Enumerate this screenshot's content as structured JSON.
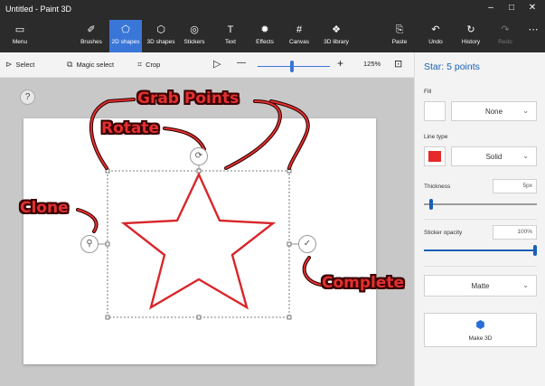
{
  "window": {
    "title": "Untitled - Paint 3D",
    "minimize": "–",
    "maximize": "□",
    "close": "✕"
  },
  "ribbon": {
    "items": [
      {
        "label": "Menu",
        "glyph": "▭"
      },
      {
        "label": "Brushes",
        "glyph": "✐"
      },
      {
        "label": "2D shapes",
        "glyph": "⬠"
      },
      {
        "label": "3D shapes",
        "glyph": "⬡"
      },
      {
        "label": "Stickers",
        "glyph": "◎"
      },
      {
        "label": "Text",
        "glyph": "T"
      },
      {
        "label": "Effects",
        "glyph": "✹"
      },
      {
        "label": "Canvas",
        "glyph": "#"
      },
      {
        "label": "3D library",
        "glyph": "❖"
      },
      {
        "label": "Paste",
        "glyph": "⎘"
      },
      {
        "label": "Undo",
        "glyph": "↶"
      },
      {
        "label": "History",
        "glyph": "↻"
      },
      {
        "label": "Redo",
        "glyph": "↷"
      },
      {
        "label": "",
        "glyph": "⋯"
      }
    ],
    "active_index": 2
  },
  "toolbar": {
    "select_label": "Select",
    "magic_select_label": "Magic select",
    "crop_label": "Crop",
    "zoom_out": "—",
    "zoom_in": "+",
    "zoom_value": "125%"
  },
  "annotations": {
    "grab_points": "Grab Points",
    "rotate": "Rotate",
    "clone": "Clone",
    "complete": "Complete"
  },
  "workspace": {
    "help_label": "?"
  },
  "panel": {
    "title": "Star: 5 points",
    "fill_label": "Fill",
    "fill_value": "None",
    "line_type_label": "Line type",
    "line_type_value": "Solid",
    "line_color": "#e62a2a",
    "thickness_label": "Thickness",
    "thickness_value": "5px",
    "opacity_label": "Sticker opacity",
    "opacity_value": "100%",
    "finish_value": "Matte",
    "make3d_label": "Make 3D",
    "thickness_level": 0.05,
    "opacity_level": 1.0
  },
  "colors": {
    "accent": "#3a76d8",
    "star_stroke": "#d8262b",
    "annotation": "#e23030"
  }
}
